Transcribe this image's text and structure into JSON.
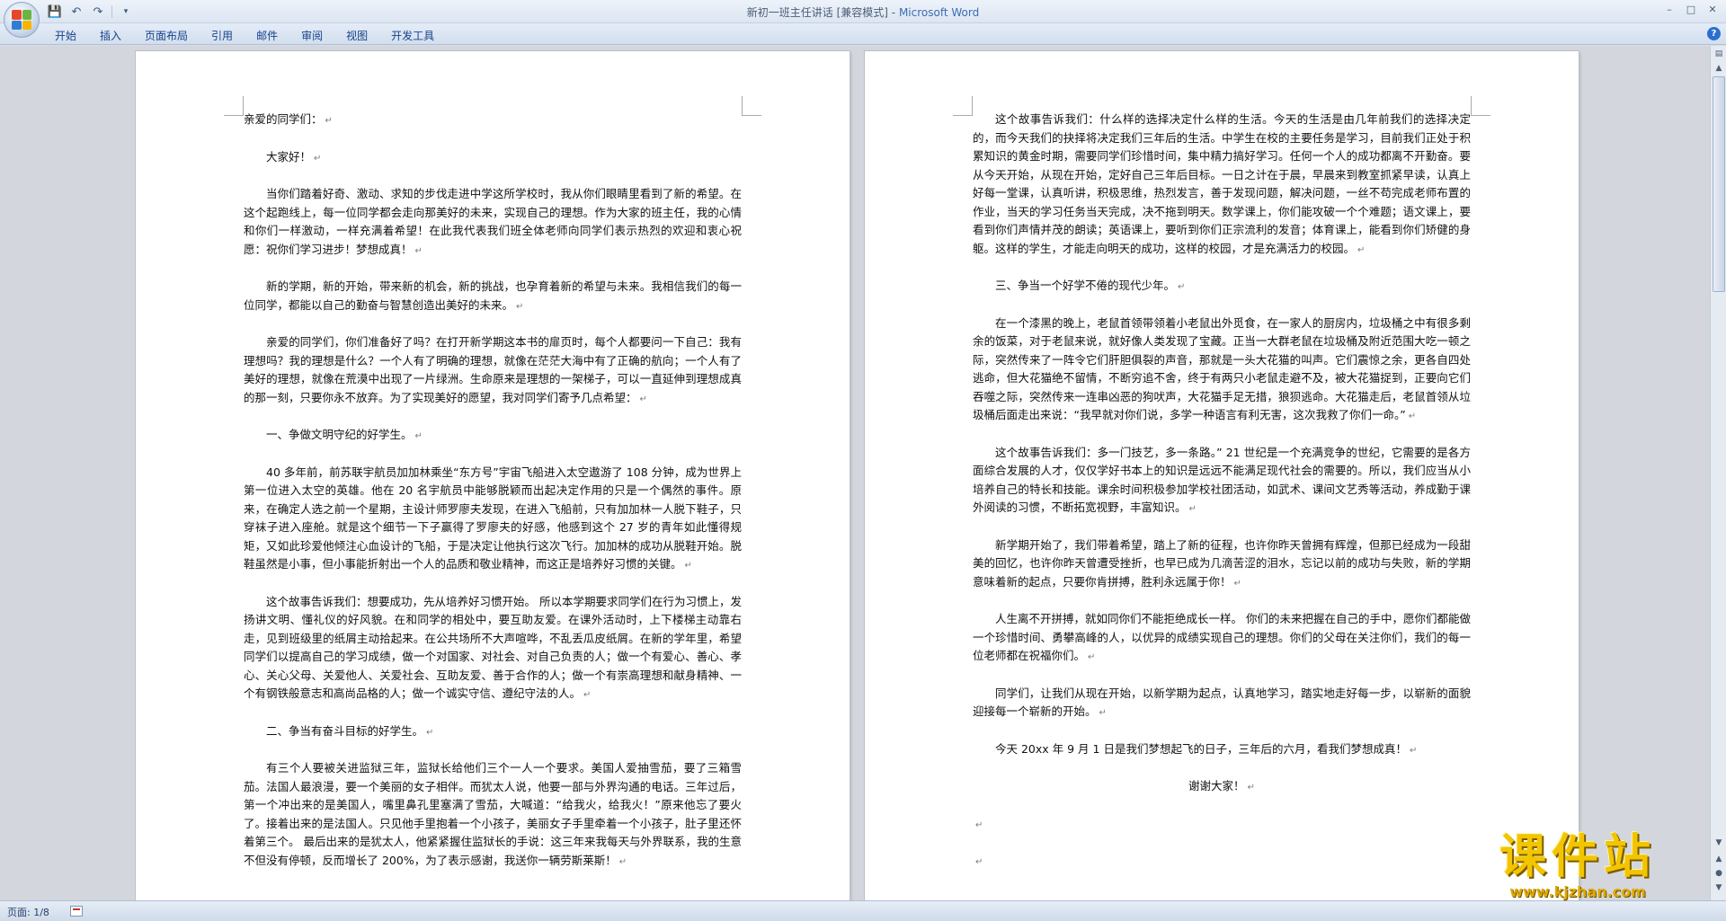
{
  "window": {
    "title": "新初一班主任讲话 [兼容模式]",
    "app_name": "Microsoft Word"
  },
  "qat": {
    "save_icon": "save-icon",
    "undo_icon": "undo-icon",
    "redo_icon": "redo-icon",
    "customize_icon": "customize-icon"
  },
  "ribbon": {
    "tabs": [
      "开始",
      "插入",
      "页面布局",
      "引用",
      "邮件",
      "审阅",
      "视图",
      "开发工具"
    ]
  },
  "status": {
    "page": "页面: 1/8"
  },
  "watermark": {
    "logo": "课件站",
    "url": "www.kjzhan.com"
  },
  "page_left": {
    "paragraphs": [
      {
        "text": "亲爱的同学们：",
        "indent": false
      },
      {
        "text": "大家好！",
        "indent": true
      },
      {
        "text": "当你们踏着好奇、激动、求知的步伐走进中学这所学校时，我从你们眼睛里看到了新的希望。在这个起跑线上，每一位同学都会走向那美好的未来，实现自己的理想。作为大家的班主任，我的心情和你们一样激动，一样充满着希望！在此我代表我们班全体老师向同学们表示热烈的欢迎和衷心祝愿：祝你们学习进步！梦想成真！",
        "indent": true
      },
      {
        "text": "新的学期，新的开始，带来新的机会，新的挑战，也孕育着新的希望与未来。我相信我们的每一位同学，都能以自己的勤奋与智慧创造出美好的未来。",
        "indent": true
      },
      {
        "text": "亲爱的同学们，你们准备好了吗？在打开新学期这本书的扉页时，每个人都要问一下自己：我有理想吗？我的理想是什么？一个人有了明确的理想，就像在茫茫大海中有了正确的航向；一个人有了美好的理想，就像在荒漠中出现了一片绿洲。生命原来是理想的一架梯子，可以一直延伸到理想成真的那一刻，只要你永不放弃。为了实现美好的愿望，我对同学们寄予几点希望：",
        "indent": true
      },
      {
        "text": "一、争做文明守纪的好学生。",
        "indent": true
      },
      {
        "text": "40 多年前，前苏联宇航员加加林乘坐“东方号”宇宙飞船进入太空遨游了 108 分钟，成为世界上第一位进入太空的英雄。他在 20 名宇航员中能够脱颖而出起决定作用的只是一个偶然的事件。原来，在确定人选之前一个星期，主设计师罗廖夫发现，在进入飞船前，只有加加林一人脱下鞋子，只穿袜子进入座舱。就是这个细节一下子赢得了罗廖夫的好感，他感到这个 27 岁的青年如此懂得规矩，又如此珍爱他倾注心血设计的飞船，于是决定让他执行这次飞行。加加林的成功从脱鞋开始。脱鞋虽然是小事，但小事能折射出一个人的品质和敬业精神，而这正是培养好习惯的关键。",
        "indent": true
      },
      {
        "text": "这个故事告诉我们：想要成功，先从培养好习惯开始。 所以本学期要求同学们在行为习惯上，发扬讲文明、懂礼仪的好风貌。在和同学的相处中，要互助友爱。在课外活动时，上下楼梯主动靠右走，见到班级里的纸屑主动拾起来。在公共场所不大声喧哗，不乱丢瓜皮纸屑。在新的学年里，希望同学们以提高自己的学习成绩，做一个对国家、对社会、对自己负责的人；做一个有爱心、善心、孝心、关心父母、关爱他人、关爱社会、互助友爱、善于合作的人；做一个有崇高理想和献身精神、一个有钢铁般意志和高尚品格的人；做一个诚实守信、遵纪守法的人。",
        "indent": true
      },
      {
        "text": "二、争当有奋斗目标的好学生。",
        "indent": true
      },
      {
        "text": "有三个人要被关进监狱三年，监狱长给他们三个一人一个要求。美国人爱抽雪茄，要了三箱雪茄。法国人最浪漫，要一个美丽的女子相伴。而犹太人说，他要一部与外界沟通的电话。三年过后，第一个冲出来的是美国人，嘴里鼻孔里塞满了雪茄，大喊道：“给我火，给我火！”原来他忘了要火了。接着出来的是法国人。只见他手里抱着一个小孩子，美丽女子手里牵着一个小孩子，肚子里还怀着第三个。 最后出来的是犹太人，他紧紧握住监狱长的手说：这三年来我每天与外界联系，我的生意不但没有停顿，反而增长了 200%，为了表示感谢，我送你一辆劳斯莱斯！",
        "indent": true
      }
    ]
  },
  "page_right": {
    "paragraphs": [
      {
        "text": "这个故事告诉我们：什么样的选择决定什么样的生活。今天的生活是由几年前我们的选择决定的，而今天我们的抉择将决定我们三年后的生活。中学生在校的主要任务是学习，目前我们正处于积累知识的黄金时期，需要同学们珍惜时间，集中精力搞好学习。任何一个人的成功都离不开勤奋。要从今天开始，从现在开始，定好自己三年后目标。一日之计在于晨，早晨来到教室抓紧早读，认真上好每一堂课，认真听讲，积极思维，热烈发言，善于发现问题，解决问题，一丝不苟完成老师布置的作业，当天的学习任务当天完成，决不拖到明天。数学课上，你们能攻破一个个难题；语文课上，要看到你们声情并茂的朗读；英语课上，要听到你们正宗流利的发音；体育课上，能看到你们矫健的身躯。这样的学生，才能走向明天的成功，这样的校园，才是充满活力的校园。",
        "indent": true
      },
      {
        "text": "三、争当一个好学不倦的现代少年。",
        "indent": true
      },
      {
        "text": "在一个漆黑的晚上，老鼠首领带领着小老鼠出外觅食，在一家人的厨房内，垃圾桶之中有很多剩余的饭菜，对于老鼠来说，就好像人类发现了宝藏。正当一大群老鼠在垃圾桶及附近范围大吃一顿之际，突然传来了一阵令它们肝胆俱裂的声音，那就是一头大花猫的叫声。它们震惊之余，更各自四处逃命，但大花猫绝不留情，不断穷追不舍，终于有两只小老鼠走避不及，被大花猫捉到，正要向它们吞噬之际，突然传来一连串凶恶的狗吠声，大花猫手足无措，狼狈逃命。大花猫走后，老鼠首领从垃圾桶后面走出来说：“我早就对你们说，多学一种语言有利无害，这次我救了你们一命。”",
        "indent": true
      },
      {
        "text": "这个故事告诉我们：多一门技艺，多一条路。” 21 世纪是一个充满竞争的世纪，它需要的是各方面综合发展的人才，仅仅学好书本上的知识是远远不能满足现代社会的需要的。所以，我们应当从小培养自己的特长和技能。课余时间积极参加学校社团活动，如武术、课间文艺秀等活动，养成勤于课外阅读的习惯，不断拓宽视野，丰富知识。",
        "indent": true
      },
      {
        "text": "新学期开始了，我们带着希望，踏上了新的征程，也许你昨天曾拥有辉煌，但那已经成为一段甜美的回忆，也许你昨天曾遭受挫折，也早已成为几滴苦涩的泪水，忘记以前的成功与失败，新的学期意味着新的起点，只要你肯拼搏，胜利永远属于你！",
        "indent": true
      },
      {
        "text": "人生离不开拼搏，就如同你们不能拒绝成长一样。 你们的未来把握在自己的手中，愿你们都能做一个珍惜时间、勇攀高峰的人，以优异的成绩实现自己的理想。你们的父母在关注你们，我们的每一位老师都在祝福你们。",
        "indent": true
      },
      {
        "text": "同学们，让我们从现在开始，以新学期为起点，认真地学习，踏实地走好每一步，以崭新的面貌迎接每一个崭新的开始。",
        "indent": true
      },
      {
        "text": "今天 20xx 年 9 月 1 日是我们梦想起飞的日子，三年后的六月，看我们梦想成真！",
        "indent": true
      },
      {
        "text": "谢谢大家！",
        "indent": false,
        "center": true
      },
      {
        "text": "",
        "indent": false
      },
      {
        "text": "",
        "indent": false
      }
    ]
  }
}
